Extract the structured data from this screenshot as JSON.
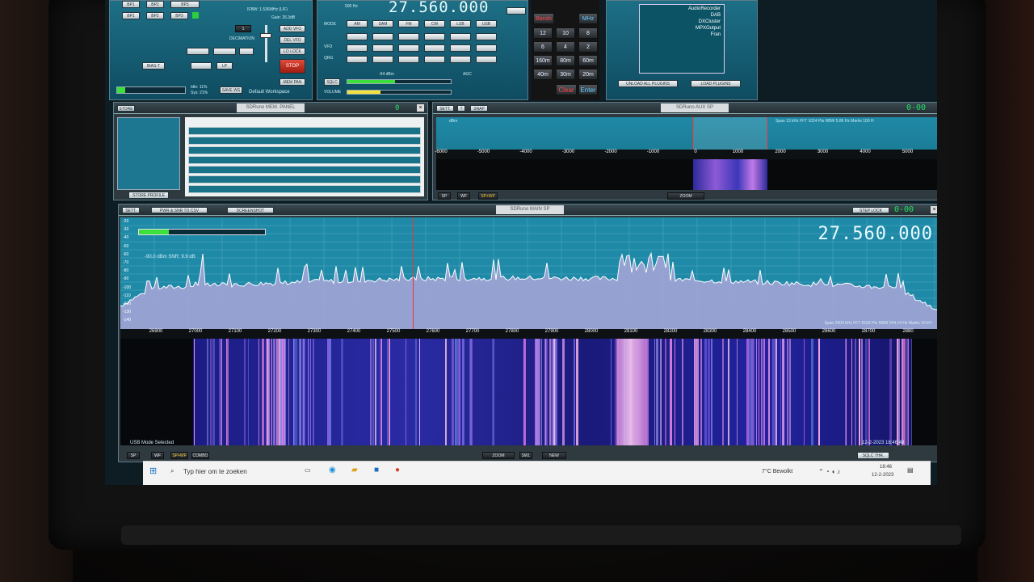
{
  "top_left": {
    "mode_buttons": [
      "BP1",
      "BP2",
      "BP3"
    ],
    "ifbw_text": "IFBW: 1.536MHz (LIF)",
    "gain_text": "Gain: 26.3dB",
    "decimation_label": "DECIMATION",
    "decimation_value": "1",
    "btn_add_vfo": "ADD VFO",
    "btn_del_vfo": "DEL VFO",
    "btn_lo_lock": "LO LOCK",
    "btn_stop": "STOP",
    "btn_bias": "BIAS-T",
    "btn_lp": "LP",
    "btn_save_ws": "SAVE WS",
    "btn_mem": "MEM PAN",
    "workspace_label": "Default Workspace",
    "level_text_1": "Idle: 11%",
    "level_text_2": "Sys: 21%"
  },
  "vfo_panel": {
    "frequency": "27.560.000",
    "step_label": "500 Hz",
    "mode_row": [
      "AM",
      "SAM",
      "FM",
      "CW",
      "LSB",
      "USB"
    ],
    "row_labels": [
      "MODE",
      "VFO",
      "QRG",
      "SQLC",
      "VOLUME"
    ],
    "dbm": "-94 dBm",
    "agc": "AGC"
  },
  "keypad": {
    "top": [
      "Bands",
      "MHz"
    ],
    "keys": [
      "12",
      "10",
      "8",
      "6",
      "4",
      "2",
      "160m",
      "80m",
      "60m",
      "40m",
      "30m",
      "20m"
    ],
    "clear": "Clear",
    "enter": "Enter"
  },
  "plugins": {
    "list": [
      "AudioRecorder",
      "DAB",
      "DXCluster",
      "MPXOutput",
      "Fran"
    ],
    "unload": "UNLOAD ALL PLUGINS",
    "load": "LOAD PLUGINS"
  },
  "mem_panel": {
    "title": "SDRuno MEM. PANEL",
    "store_btn": "STORE",
    "store_profile": "STORE PROFILE",
    "counter": "0"
  },
  "aux_sp": {
    "title": "SDRuno AUX SP",
    "btns": [
      "SETT.",
      "?",
      "SNAP"
    ],
    "info": "Span 13 kHz  FFT 1024 Pts  RBW 5.86 Hz  Marks 100 H",
    "ticks": [
      "-6000",
      "-5000",
      "-4000",
      "-3000",
      "-2000",
      "-1000",
      "0",
      "1000",
      "2000",
      "3000",
      "4000",
      "5000",
      "60"
    ],
    "ylabel": "dBm",
    "zoom": "ZOOM",
    "bottom_btns": [
      "SP",
      "WF",
      "SP+WF"
    ],
    "clock": "0-00"
  },
  "main_sp": {
    "title": "SDRuno MAIN SP",
    "btns": [
      "SETT.",
      "PWR & SNR TO CSV",
      "SCREENSHOT"
    ],
    "step_lock": "STEP LOCK",
    "clock": "0-00",
    "frequency": "27.560.000",
    "db_marks": [
      "-20",
      "-30",
      "-40",
      "-50",
      "-60",
      "-70",
      "-80",
      "-90",
      "-100",
      "-110",
      "-120",
      "-130",
      "-140"
    ],
    "readout": "-90.0 dBm   SNR: 9.9 dB",
    "info": "Span 2000 kHz  FFT 8192 Pts  RBW 244.14 Hz  Marks 10 kH",
    "freq_ticks": [
      "26900",
      "27000",
      "27100",
      "27200",
      "27300",
      "27400",
      "27500",
      "27600",
      "27700",
      "27800",
      "27900",
      "28000",
      "28100",
      "28200",
      "28300",
      "28400",
      "28500",
      "28600",
      "28700",
      "2880"
    ],
    "status": "USB Mode Selected",
    "datetime": "12-2-2023 18:46:49",
    "bottom_btns": [
      "SP",
      "WF",
      "SP+WF",
      "COMBO"
    ],
    "zoom": "ZOOM",
    "nav_btns": [
      "SWL",
      "NEW"
    ],
    "sqlc_btn": "SQLC THR."
  },
  "taskbar": {
    "search_placeholder": "Typ hier om te zoeken",
    "weather": "7°C  Bewolkt",
    "time": "18:46",
    "date": "12-2-2023"
  },
  "colors": {
    "panel": "#1a6a82",
    "spectrum_fill": "#a9a4d8",
    "waterfall": "#1c1e8a",
    "accent_red": "#c8281c",
    "lcd_green": "#20e060"
  }
}
